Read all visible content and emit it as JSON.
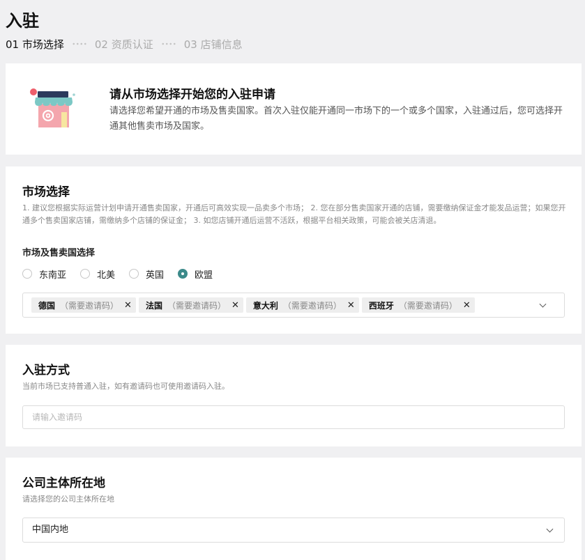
{
  "page": {
    "title": "入驻"
  },
  "steps": [
    {
      "label": "01 市场选择",
      "active": true
    },
    {
      "label": "02 资质认证",
      "active": false
    },
    {
      "label": "03 店铺信息",
      "active": false
    }
  ],
  "intro": {
    "title": "请从市场选择开始您的入驻申请",
    "desc": "请选择您希望开通的市场及售卖国家。首次入驻仅能开通同一市场下的一个或多个国家，入驻通过后，您可选择开通其他售卖市场及国家。",
    "illustration_icon": "storefront-icon"
  },
  "market": {
    "title": "市场选择",
    "desc": "1. 建议您根据实际运营计划申请开通售卖国家，开通后可高效实现一品卖多个市场； 2. 您在部分售卖国家开通的店铺，需要缴纳保证金才能发品运营；如果您开通多个售卖国家店铺，需缴纳多个店铺的保证金； 3. 如您店铺开通后运营不活跃，根据平台相关政策，可能会被关店清退。",
    "subtitle": "市场及售卖国选择",
    "options": [
      {
        "label": "东南亚",
        "checked": false
      },
      {
        "label": "北美",
        "checked": false
      },
      {
        "label": "英国",
        "checked": false
      },
      {
        "label": "欧盟",
        "checked": true
      }
    ],
    "tags": [
      {
        "name": "德国",
        "note": "（需要邀请码）"
      },
      {
        "name": "法国",
        "note": "（需要邀请码）"
      },
      {
        "name": "意大利",
        "note": "（需要邀请码）"
      },
      {
        "name": "西班牙",
        "note": "（需要邀请码）"
      }
    ],
    "tag_close_glyph": "✕",
    "accent_color": "#3c8a8a"
  },
  "mode": {
    "title": "入驻方式",
    "desc": "当前市场已支持普通入驻，如有邀请码也可使用邀请码入驻。",
    "input_placeholder": "请输入邀请码",
    "input_value": ""
  },
  "company": {
    "title": "公司主体所在地",
    "desc": "请选择您的公司主体所在地",
    "selected": "中国内地"
  }
}
